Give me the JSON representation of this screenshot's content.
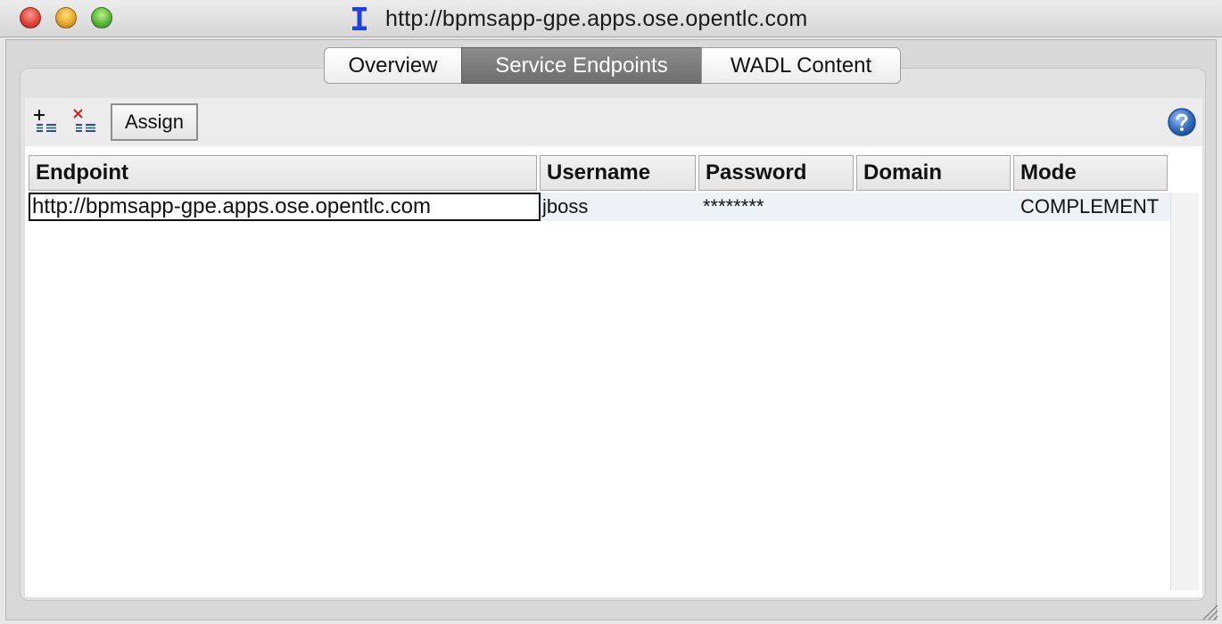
{
  "window": {
    "title": "http://bpmsapp-gpe.apps.ose.opentlc.com",
    "controls": [
      "close",
      "minimize",
      "maximize"
    ],
    "app_icon": "rest-service-icon"
  },
  "tabs": [
    {
      "label": "Overview",
      "active": false
    },
    {
      "label": "Service Endpoints",
      "active": true
    },
    {
      "label": "WADL Content",
      "active": false
    }
  ],
  "toolbar": {
    "add_icon": "add-endpoint-icon",
    "delete_icon": "delete-endpoint-icon",
    "assign_label": "Assign",
    "help_icon": "help-icon"
  },
  "table": {
    "columns": [
      "Endpoint",
      "Username",
      "Password",
      "Domain",
      "Mode"
    ],
    "rows": [
      {
        "endpoint": "http://bpmsapp-gpe.apps.ose.opentlc.com",
        "username": "jboss",
        "password": "********",
        "domain": "",
        "mode": "COMPLEMENT"
      }
    ]
  },
  "colors": {
    "active_tab": "#7a7a7a",
    "selected_row": "#edf2f7",
    "help_blue": "#3f74c6"
  }
}
